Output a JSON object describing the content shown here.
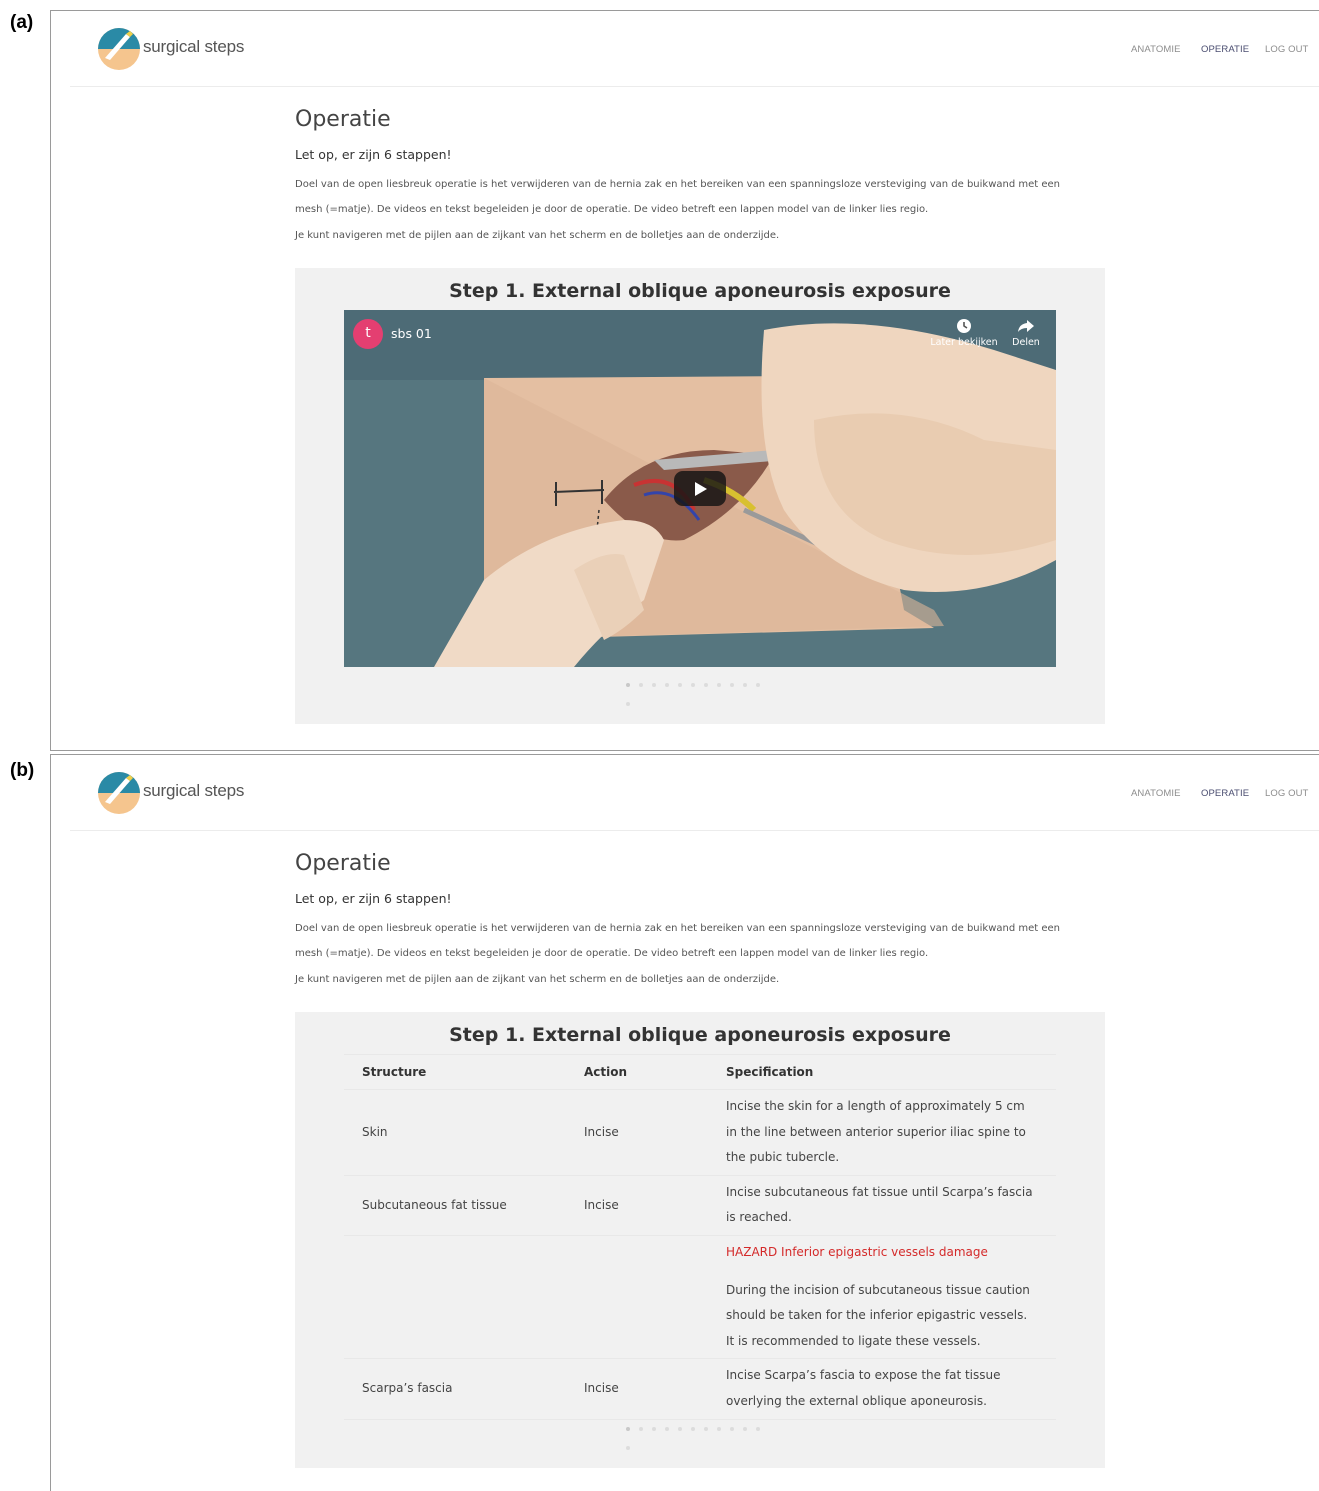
{
  "panels": [
    {
      "letter": "(a)",
      "header": {
        "logo_text": "surgical steps",
        "logo_icon": "scalpel-logo-icon",
        "nav": [
          "ANATOMIE",
          "OPERATIE",
          "LOG OUT"
        ],
        "active_nav": "OPERATIE"
      },
      "page": {
        "title": "Operatie",
        "warning": "Let op, er zijn 6 stappen!",
        "intro_lines": [
          "Doel van de open liesbreuk operatie is het verwijderen van de hernia zak en het bereiken van een spanningsloze versteviging van de buikwand met een",
          "mesh (=matje). De videos en tekst begeleiden je door de operatie. De video betreft een lappen model van de linker lies regio.",
          "Je kunt navigeren met de pijlen aan de zijkant van het scherm en de bolletjes aan de onderzijde."
        ]
      },
      "step": {
        "title": "Step 1. External oblique aponeurosis exposure",
        "video": {
          "channel_initial": "t",
          "title": "sbs 01",
          "watch_later": "Later bekijken",
          "share": "Delen",
          "play_icon": "play-icon"
        },
        "dot_count": 12,
        "active_dot": 0
      }
    },
    {
      "letter": "(b)",
      "header": {
        "logo_text": "surgical steps",
        "logo_icon": "scalpel-logo-icon",
        "nav": [
          "ANATOMIE",
          "OPERATIE",
          "LOG OUT"
        ],
        "active_nav": "OPERATIE"
      },
      "page": {
        "title": "Operatie",
        "warning": "Let op, er zijn 6 stappen!",
        "intro_lines": [
          "Doel van de open liesbreuk operatie is het verwijderen van de hernia zak en het bereiken van een spanningsloze versteviging van de buikwand met een",
          "mesh (=matje). De videos en tekst begeleiden je door de operatie. De video betreft een lappen model van de linker lies regio.",
          "Je kunt navigeren met de pijlen aan de zijkant van het scherm en de bolletjes aan de onderzijde."
        ]
      },
      "step": {
        "title": "Step 1. External oblique aponeurosis exposure",
        "table": {
          "headers": [
            "Structure",
            "Action",
            "Specification"
          ],
          "rows": [
            {
              "structure": "Skin",
              "action": "Incise",
              "spec": "Incise the skin for a length of approximately 5 cm in the line between anterior superior iliac spine to the pubic tubercle."
            },
            {
              "structure": "Subcutaneous fat tissue",
              "action": "Incise",
              "spec": "Incise subcutaneous fat tissue until Scarpa’s fascia is reached."
            },
            {
              "structure": "",
              "action": "",
              "hazard": "HAZARD Inferior epigastric vessels damage",
              "spec": "During the incision of subcutaneous tissue caution should be taken for the inferior epigastric vessels. It is recommended to ligate these vessels."
            },
            {
              "structure": "Scarpa’s fascia",
              "action": "Incise",
              "spec": "Incise Scarpa’s fascia to expose the fat tissue overlying the external oblique aponeurosis."
            }
          ]
        },
        "dot_count": 12,
        "active_dot": 0
      }
    }
  ],
  "colors": {
    "accent_teal": "#2a8aa6",
    "accent_peach": "#f5c58e",
    "nav_active": "#4a4d70",
    "hazard_red": "#d42a2a",
    "youtube_avatar": "#e43f71"
  }
}
